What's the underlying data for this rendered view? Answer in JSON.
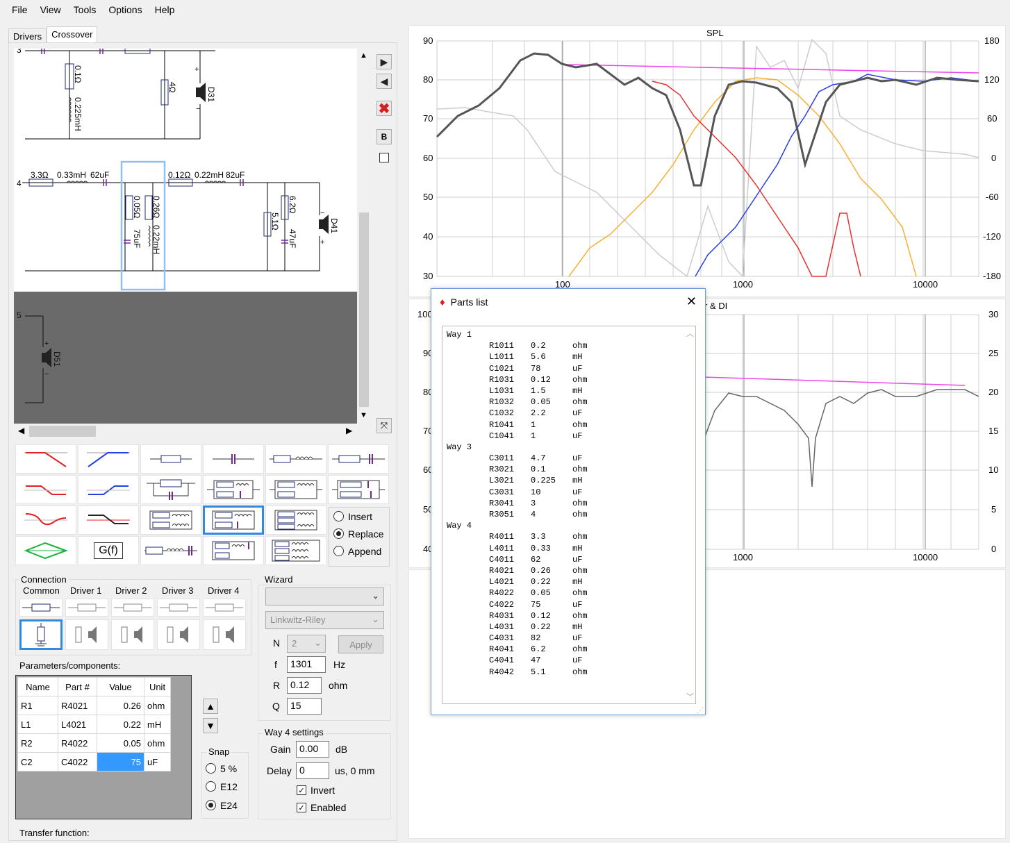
{
  "menu": [
    "File",
    "View",
    "Tools",
    "Options",
    "Help"
  ],
  "tabs": [
    "Drivers",
    "Crossover"
  ],
  "schematic": {
    "way3_label": "3",
    "way4_label": "4",
    "way5_label": "5",
    "r_way3": "0.1Ω",
    "l_way3": "0.225mH",
    "r_load3": "4Ω",
    "driver3": "D31",
    "r_top": "3.3Ω",
    "l_top": "0.33mH",
    "c_top": "62uF",
    "r2_top": "0.12Ω",
    "l2_top": "0.22mH",
    "c2_top": "82uF",
    "r_sh1": "0.05Ω",
    "r_sh2": "0.26Ω",
    "l_sh2": "0.22mH",
    "c_sh": "75uF",
    "r_shb": "5.1Ω",
    "r_sha": "6.2Ω",
    "c_shb": "47uF",
    "driver4": "D41",
    "driver5": "D51",
    "plus": "+",
    "minus": "−"
  },
  "side_buttons": {
    "b_label": "B"
  },
  "tools": {
    "gf_label": "G(f)"
  },
  "mode": {
    "options": [
      "Insert",
      "Replace",
      "Append"
    ],
    "selected": "Replace"
  },
  "connection": {
    "title": "Connection",
    "columns": [
      "Common",
      "Driver 1",
      "Driver 2",
      "Driver 3",
      "Driver 4"
    ]
  },
  "wizard": {
    "title": "Wizard",
    "type_value": "",
    "filter": "Linkwitz-Riley",
    "n_label": "N",
    "n_value": "2",
    "apply_label": "Apply",
    "f_label": "f",
    "f_value": "1301",
    "f_unit": "Hz",
    "r_label": "R",
    "r_value": "0.12",
    "r_unit": "ohm",
    "q_label": "Q",
    "q_value": "15"
  },
  "params": {
    "title": "Parameters/components:",
    "headers": [
      "Name",
      "Part #",
      "Value",
      "Unit"
    ],
    "rows": [
      {
        "name": "R1",
        "part": "R4021",
        "value": "0.26",
        "unit": "ohm"
      },
      {
        "name": "L1",
        "part": "L4021",
        "value": "0.22",
        "unit": "mH"
      },
      {
        "name": "R2",
        "part": "R4022",
        "value": "0.05",
        "unit": "ohm"
      },
      {
        "name": "C2",
        "part": "C4022",
        "value": "75",
        "unit": "uF"
      }
    ]
  },
  "snap": {
    "title": "Snap",
    "options": [
      "5 %",
      "E12",
      "E24"
    ],
    "selected": "E24"
  },
  "way_settings": {
    "title": "Way 4 settings",
    "gain_label": "Gain",
    "gain_value": "0.00",
    "gain_unit": "dB",
    "delay_label": "Delay",
    "delay_value": "0",
    "delay_unit": "us, 0 mm",
    "invert_label": "Invert",
    "enabled_label": "Enabled"
  },
  "transfer_label": "Transfer function:",
  "spl_chart": {
    "title": "SPL",
    "y_left": [
      "90",
      "80",
      "70",
      "60",
      "50",
      "40",
      "30"
    ],
    "y_right": [
      "180",
      "120",
      "60",
      "0",
      "-60",
      "-120",
      "-180"
    ],
    "x_ticks": [
      "100",
      "1000",
      "10000"
    ]
  },
  "chart2": {
    "title": "r & DI",
    "y_left": [
      "100",
      "90",
      "80",
      "70",
      "60",
      "50",
      "40"
    ],
    "y_right": [
      "30",
      "25",
      "20",
      "15",
      "10",
      "5",
      "0"
    ],
    "x_ticks": [
      "1000",
      "10000"
    ]
  },
  "colors": {
    "accent": "#2f8ae0",
    "red": "#e53030",
    "blue": "#2a3de0",
    "orange": "#f5b030",
    "magenta": "#ee44ee",
    "total": "#555555"
  },
  "dialog": {
    "title": "Parts list",
    "icon": "gem-icon",
    "ways": [
      {
        "label": "Way 1",
        "parts": [
          [
            "R1011",
            "0.2",
            "ohm"
          ],
          [
            "L1011",
            "5.6",
            "mH"
          ],
          [
            "C1021",
            "78",
            "uF"
          ],
          [
            "R1031",
            "0.12",
            "ohm"
          ],
          [
            "L1031",
            "1.5",
            "mH"
          ],
          [
            "R1032",
            "0.05",
            "ohm"
          ],
          [
            "C1032",
            "2.2",
            "uF"
          ],
          [
            "R1041",
            "1",
            "ohm"
          ],
          [
            "C1041",
            "1",
            "uF"
          ]
        ]
      },
      {
        "label": "Way 3",
        "parts": [
          [
            "C3011",
            "4.7",
            "uF"
          ],
          [
            "R3021",
            "0.1",
            "ohm"
          ],
          [
            "L3021",
            "0.225",
            "mH"
          ],
          [
            "C3031",
            "10",
            "uF"
          ],
          [
            "R3041",
            "3",
            "ohm"
          ],
          [
            "R3051",
            "4",
            "ohm"
          ]
        ]
      },
      {
        "label": "Way 4",
        "parts": [
          [
            "R4011",
            "3.3",
            "ohm"
          ],
          [
            "L4011",
            "0.33",
            "mH"
          ],
          [
            "C4011",
            "62",
            "uF"
          ],
          [
            "R4021",
            "0.26",
            "ohm"
          ],
          [
            "L4021",
            "0.22",
            "mH"
          ],
          [
            "R4022",
            "0.05",
            "ohm"
          ],
          [
            "C4022",
            "75",
            "uF"
          ],
          [
            "R4031",
            "0.12",
            "ohm"
          ],
          [
            "L4031",
            "0.22",
            "mH"
          ],
          [
            "C4031",
            "82",
            "uF"
          ],
          [
            "R4041",
            "6.2",
            "ohm"
          ],
          [
            "C4041",
            "47",
            "uF"
          ],
          [
            "R4042",
            "5.1",
            "ohm"
          ]
        ]
      }
    ]
  }
}
